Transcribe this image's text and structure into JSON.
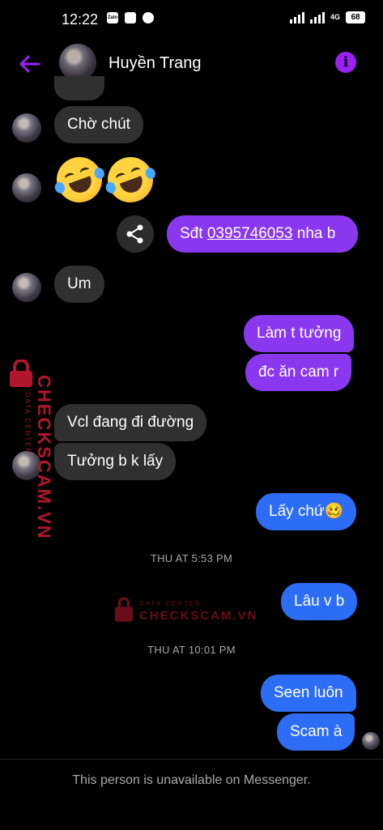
{
  "status_bar": {
    "time": "12:22",
    "left_icons": [
      "zalo-icon",
      "image-icon",
      "messenger-icon"
    ],
    "zalo_label": "Zalo",
    "network": "4G",
    "battery": "68"
  },
  "header": {
    "contact_name": "Huyền Trang",
    "back_icon": "arrow-left-icon",
    "info_icon": "info-icon",
    "accent_color": "#9b21f3"
  },
  "messages": {
    "m1": "Chờ chút",
    "m2_emoji": "rolling-on-floor-laughing x2",
    "m3_prefix": "Sđt ",
    "m3_phone": "0395746053",
    "m3_suffix": " nha b",
    "m4": "Um",
    "m5": "Làm t tưởng",
    "m6": "đc ăn cam r",
    "m7": "Vcl đang đi đường",
    "m8": "Tưởng b k lấy",
    "m9": "Lấy chứ🥴",
    "ts1": "THU AT 5:53 PM",
    "m10": "Lâu v b",
    "ts2": "THU AT 10:01 PM",
    "m11": "Seen luôn",
    "m12": "Scam à"
  },
  "colors": {
    "incoming": "#303030",
    "outgoing_purple": "#8a38f0",
    "outgoing_blue": "#2d6df6",
    "watermark": "#b0162c"
  },
  "watermark": {
    "small": "DATA CENTER",
    "big": "CHECKSCAM.VN"
  },
  "footer": {
    "notice": "This person is unavailable on Messenger."
  }
}
